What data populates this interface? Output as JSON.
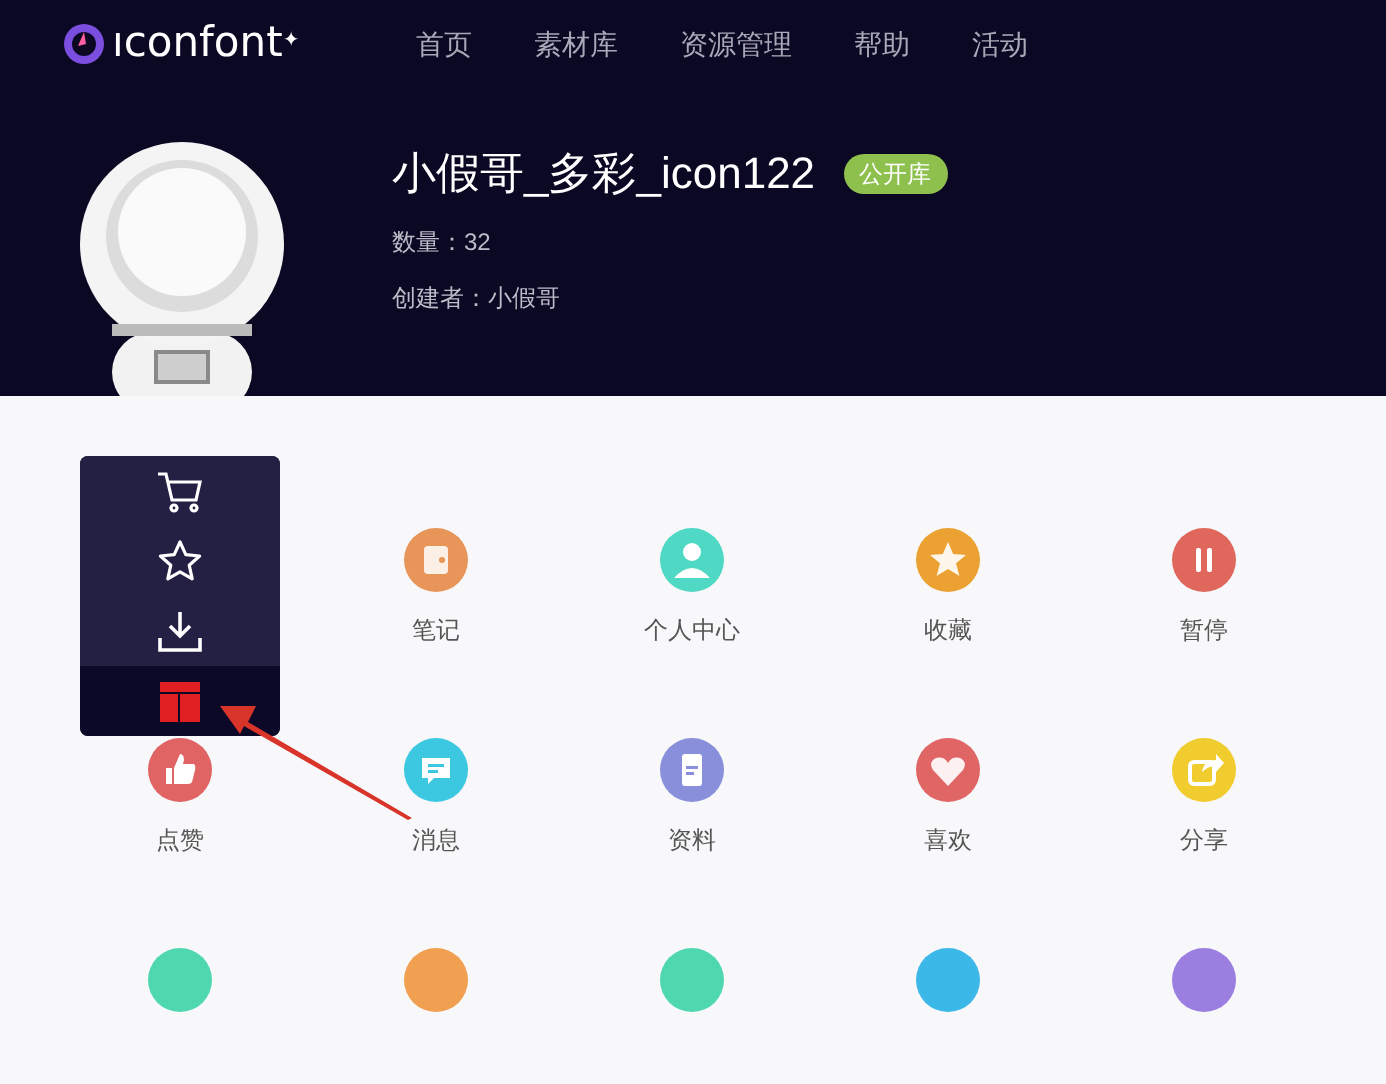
{
  "brand": {
    "name": "ıconfont",
    "mark": "✦"
  },
  "nav": [
    {
      "label": "首页"
    },
    {
      "label": "素材库"
    },
    {
      "label": "资源管理"
    },
    {
      "label": "帮助"
    },
    {
      "label": "活动"
    }
  ],
  "project": {
    "title": "小假哥_多彩_icon122",
    "badge": "公开库",
    "count": "数量：32",
    "creator": "创建者：小假哥"
  },
  "hover_toolbar": [
    {
      "kind": "cart",
      "selected": false
    },
    {
      "kind": "star",
      "selected": false
    },
    {
      "kind": "download",
      "selected": false
    },
    {
      "kind": "code",
      "selected": true
    }
  ],
  "icons": [
    {
      "kind": "hidden"
    },
    {
      "kind": "note",
      "label": "笔记",
      "color": "#e8955a"
    },
    {
      "kind": "user",
      "label": "个人中心",
      "color": "#4fd8c4"
    },
    {
      "kind": "star",
      "label": "收藏",
      "color": "#eba233"
    },
    {
      "kind": "pause",
      "label": "暂停",
      "color": "#e0675c"
    },
    {
      "kind": "thumb",
      "label": "点赞",
      "color": "#e06464"
    },
    {
      "kind": "message",
      "label": "消息",
      "color": "#3cc8e0"
    },
    {
      "kind": "document",
      "label": "资料",
      "color": "#8a8fdc"
    },
    {
      "kind": "heart",
      "label": "喜欢",
      "color": "#e06666"
    },
    {
      "kind": "share",
      "label": "分享",
      "color": "#f0cc2e"
    },
    {
      "kind": "blank",
      "color": "#4fd8b0"
    },
    {
      "kind": "blank",
      "color": "#f0a050"
    },
    {
      "kind": "blank",
      "color": "#4fd8b0"
    },
    {
      "kind": "blank",
      "color": "#3cb8e8"
    },
    {
      "kind": "blank",
      "color": "#9a7ee0"
    }
  ]
}
